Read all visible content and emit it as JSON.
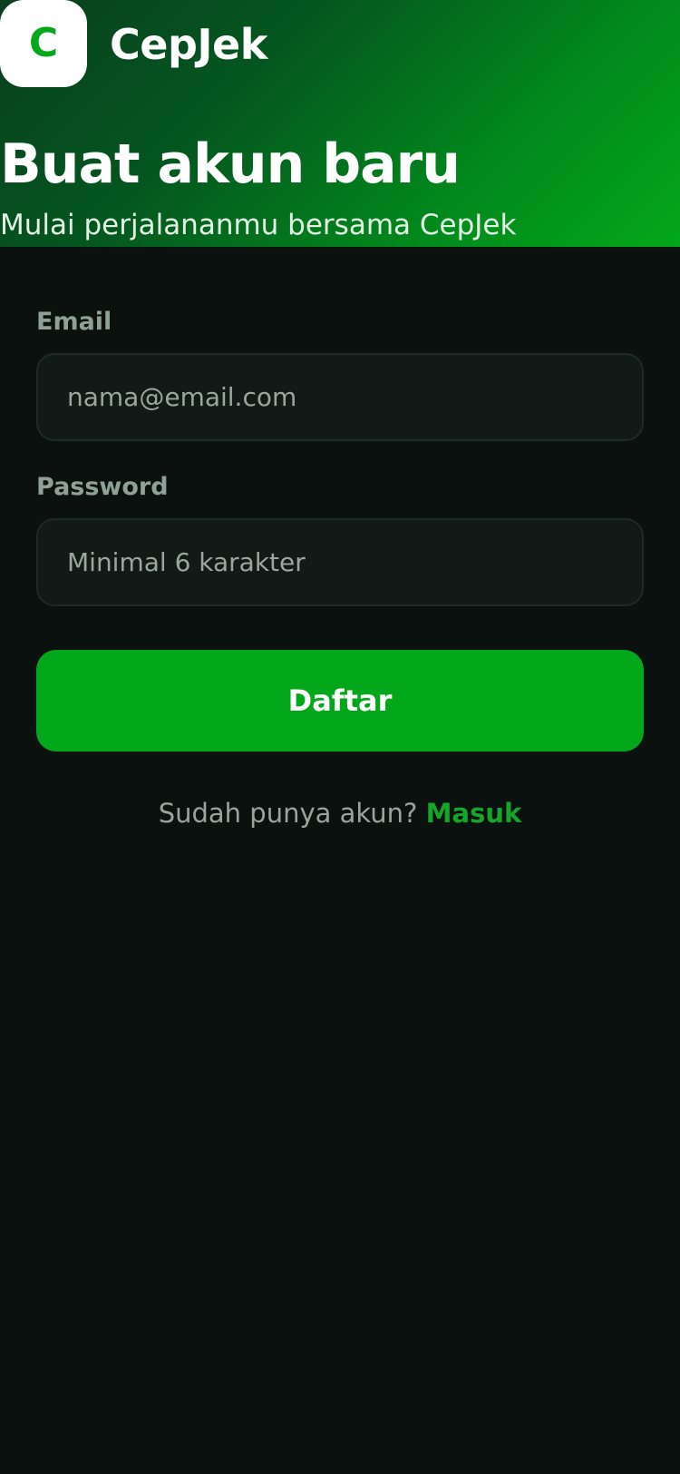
{
  "brand": {
    "logo_letter": "C",
    "name": "CepJek"
  },
  "hero": {
    "title": "Buat akun baru",
    "subtitle": "Mulai perjalananmu bersama CepJek"
  },
  "form": {
    "email": {
      "label": "Email",
      "placeholder": "nama@email.com",
      "value": ""
    },
    "password": {
      "label": "Password",
      "placeholder": "Minimal 6 karakter",
      "value": ""
    },
    "submit_label": "Daftar"
  },
  "footer": {
    "prompt": "Sudah punya akun?",
    "link_label": "Masuk"
  },
  "colors": {
    "accent": "#03a81a",
    "background": "#0b110e",
    "header_gradient_start": "#0a3f1e",
    "header_gradient_end": "#03a81a"
  }
}
